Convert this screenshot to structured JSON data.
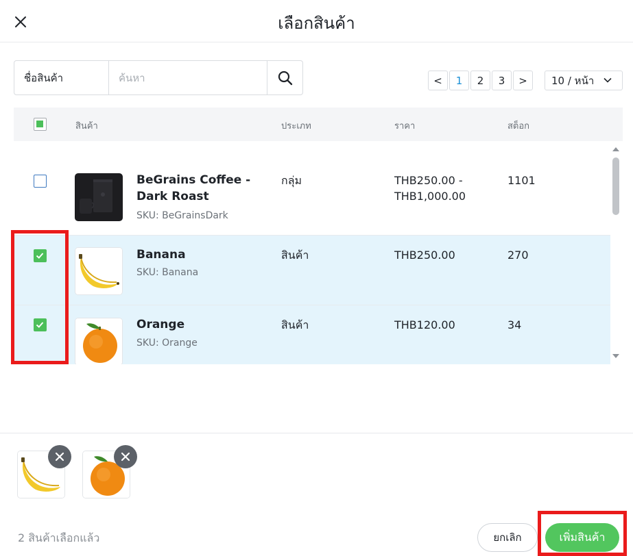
{
  "header": {
    "title": "เลือกสินค้า"
  },
  "search": {
    "field_label": "ชื่อสินค้า",
    "placeholder": "ค้นหา"
  },
  "pagination": {
    "prev": "<",
    "pages": [
      "1",
      "2",
      "3"
    ],
    "next": ">",
    "page_size": "10 / หน้า"
  },
  "table": {
    "headers": {
      "product": "สินค้า",
      "type": "ประเภท",
      "price": "ราคา",
      "stock": "สต็อก"
    },
    "rows": [
      {
        "name": "BeGrains Coffee - Dark Roast",
        "sku": "SKU: BeGrainsDark",
        "type": "กลุ่ม",
        "price": "THB250.00 - THB1,000.00",
        "stock": "1101",
        "checked": false
      },
      {
        "name": "Banana",
        "sku": "SKU: Banana",
        "type": "สินค้า",
        "price": "THB250.00",
        "stock": "270",
        "checked": true
      },
      {
        "name": "Orange",
        "sku": "SKU: Orange",
        "type": "สินค้า",
        "price": "THB120.00",
        "stock": "34",
        "checked": true
      }
    ]
  },
  "footer": {
    "selected_count": "2 สินค้าเลือกแล้ว",
    "cancel_label": "ยกเลิก",
    "add_label": "เพิ่มสินค้า"
  },
  "colors": {
    "accent_green": "#52c65e",
    "highlight_red": "#ea1b1b",
    "selected_row": "#e4f4fc",
    "link_blue": "#1a8fd6"
  },
  "icons": [
    "close-icon",
    "search-icon",
    "chevron-down-icon",
    "check-icon",
    "remove-icon"
  ]
}
